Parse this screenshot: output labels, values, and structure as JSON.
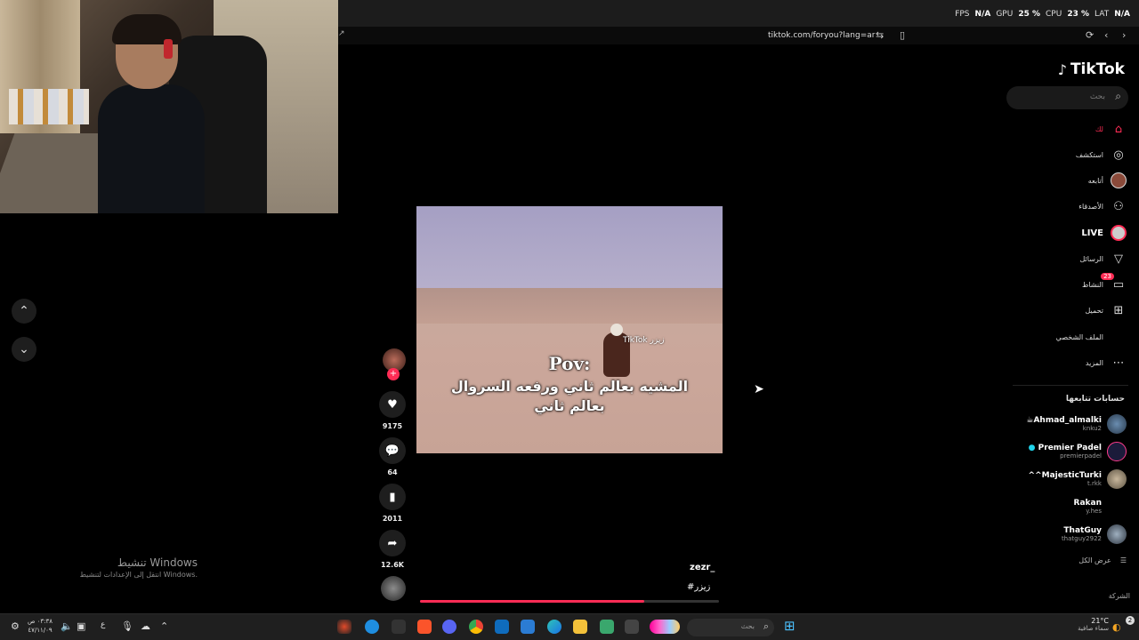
{
  "system_stats": {
    "fps_label": "FPS",
    "fps_value": "N/A",
    "gpu_label": "GPU",
    "gpu_value": "25 %",
    "cpu_label": "CPU",
    "cpu_value": "23 %",
    "lat_label": "LAT",
    "lat_value": "N/A"
  },
  "browser": {
    "url": "tiktok.com/foryou?lang=ar",
    "left_text": "↗"
  },
  "tiktok": {
    "logo": "TikTok",
    "search_placeholder": "بحث",
    "nav": [
      {
        "label": "لك",
        "icon": "home-icon"
      },
      {
        "label": "استكشف",
        "icon": "compass-icon"
      },
      {
        "label": "أتابعه",
        "icon": "following-avatar-icon"
      },
      {
        "label": "الأصدقاء",
        "icon": "friends-icon"
      },
      {
        "label": "LIVE",
        "icon": "live-icon"
      },
      {
        "label": "الرسائل",
        "icon": "send-icon"
      },
      {
        "label": "النشاط",
        "icon": "activity-icon",
        "badge": "23"
      },
      {
        "label": "تحميل",
        "icon": "upload-icon"
      },
      {
        "label": "الملف الشخصي",
        "icon": "profile-icon"
      },
      {
        "label": "المزيد",
        "icon": "more-icon"
      }
    ],
    "following_title": "حسابات تتابعها",
    "accounts": [
      {
        "name": "Ahmad_almalki",
        "handle": "knku2",
        "prefix": "☕"
      },
      {
        "name": "Premier Padel",
        "handle": "premierpadel",
        "prefix": "●"
      },
      {
        "name": "^^MajesticTurki",
        "handle": "t.rkk",
        "prefix": ""
      },
      {
        "name": "Rakan",
        "handle": "y.hes",
        "prefix": ""
      },
      {
        "name": "ThatGuy",
        "handle": "thatguy2922",
        "prefix": ""
      }
    ],
    "see_all": "عرض الكل",
    "company": "الشركة"
  },
  "video": {
    "pov": "Pov:",
    "caption_line1": "المشيه بعالم ثاني ورفعه السروال",
    "caption_line2": "بعالم ثاني",
    "watermark": "TikTok زيزر",
    "author": "zezr_",
    "hashtag": "#زيزر",
    "progress": 0.75
  },
  "actions": {
    "likes": "9175",
    "comments": "64",
    "saves": "2011",
    "shares": "12.6K"
  },
  "activation": {
    "title": "تنشيط Windows",
    "subtitle": "انتقل إلى الإعدادات لتنشيط Windows."
  },
  "taskbar": {
    "time": "٠٣:٣٨ ص",
    "date": "٤٧/١١/٠٩",
    "search_placeholder": "بحث",
    "weather_temp": "21°C",
    "weather_desc": "سماء صافية",
    "notif_count": "2",
    "lang": "ع"
  }
}
